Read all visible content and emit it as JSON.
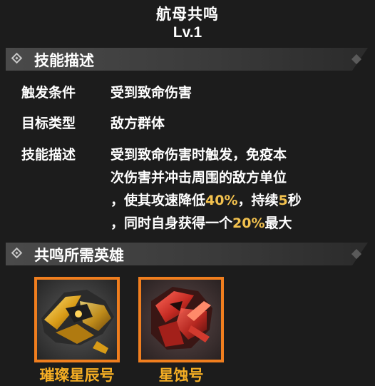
{
  "header": {
    "title": "航母共鸣",
    "level": "Lv.1"
  },
  "skill_section": {
    "heading": "技能描述",
    "rows": [
      {
        "label": "触发条件",
        "value": "受到致命伤害"
      },
      {
        "label": "目标类型",
        "value": "敌方群体"
      },
      {
        "label": "技能描述"
      }
    ],
    "description_lines": [
      {
        "t1": "受到致命伤害时触发，免疫本"
      },
      {
        "t1": "次伤害并冲击周围的敌方单位"
      },
      {
        "t1": "，使其攻速降低",
        "h1": "40%",
        "t2": "，持续",
        "h2": "5",
        "t3": "秒"
      },
      {
        "t1": "，同时自身获得一个",
        "h1": "20%",
        "t2": "最大"
      }
    ]
  },
  "heroes_section": {
    "heading": "共鸣所需英雄",
    "heroes": [
      {
        "name": "璀璨星辰号",
        "icon": "golden-ship-icon"
      },
      {
        "name": "星蚀号",
        "icon": "crimson-ship-icon"
      }
    ]
  },
  "colors": {
    "background": "#1c1c1c",
    "highlight": "#f2c14e",
    "card_border": "#f07e1e",
    "hero_name": "#f5ae24"
  }
}
